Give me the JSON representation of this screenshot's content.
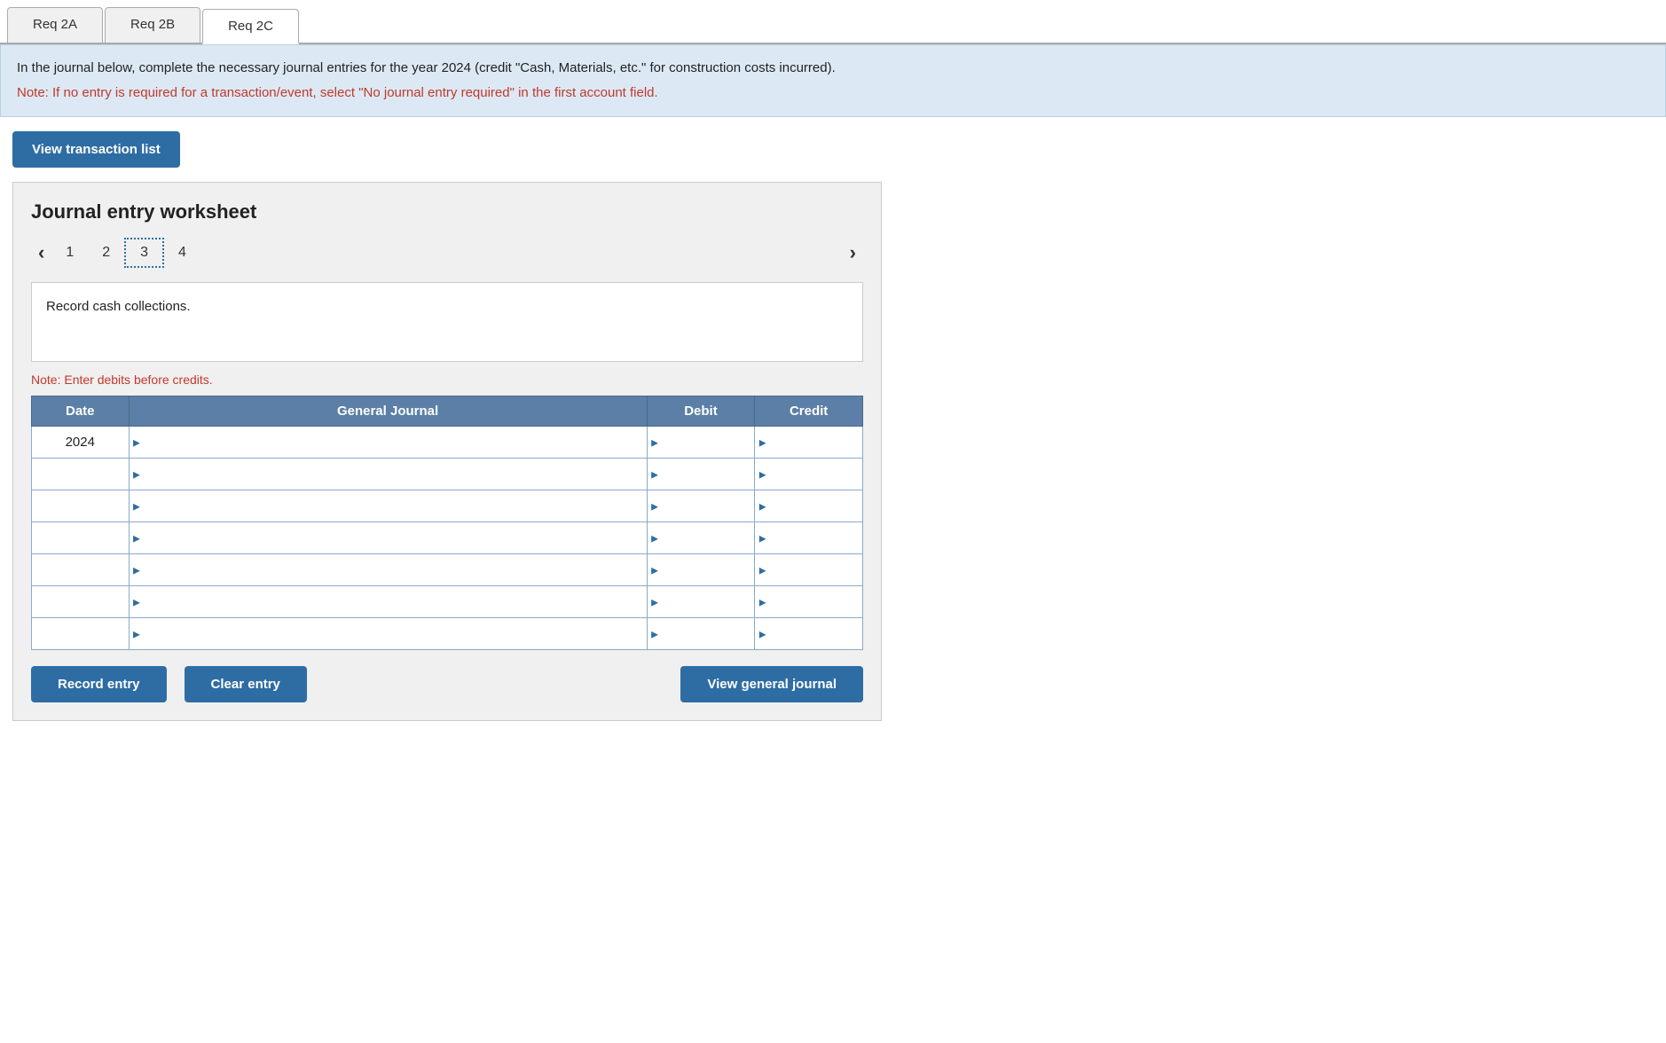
{
  "tabs": [
    {
      "id": "req2a",
      "label": "Req 2A",
      "active": false
    },
    {
      "id": "req2b",
      "label": "Req 2B",
      "active": false
    },
    {
      "id": "req2c",
      "label": "Req 2C",
      "active": true
    }
  ],
  "instruction": {
    "main": "In the journal below, complete the necessary journal entries for the year 2024 (credit \"Cash, Materials, etc.\" for construction costs incurred).",
    "note": "Note: If no entry is required for a transaction/event, select \"No journal entry required\" in the first account field."
  },
  "view_transaction_btn": "View transaction list",
  "worksheet": {
    "title": "Journal entry worksheet",
    "steps": [
      {
        "num": "1",
        "active": false
      },
      {
        "num": "2",
        "active": false
      },
      {
        "num": "3",
        "active": true
      },
      {
        "num": "4",
        "active": false
      }
    ],
    "record_description": "Record cash collections.",
    "note_debits": "Note: Enter debits before credits.",
    "table": {
      "headers": [
        "Date",
        "General Journal",
        "Debit",
        "Credit"
      ],
      "rows": [
        {
          "date": "2024",
          "gj": "",
          "debit": "",
          "credit": ""
        },
        {
          "date": "",
          "gj": "",
          "debit": "",
          "credit": ""
        },
        {
          "date": "",
          "gj": "",
          "debit": "",
          "credit": ""
        },
        {
          "date": "",
          "gj": "",
          "debit": "",
          "credit": ""
        },
        {
          "date": "",
          "gj": "",
          "debit": "",
          "credit": ""
        },
        {
          "date": "",
          "gj": "",
          "debit": "",
          "credit": ""
        },
        {
          "date": "",
          "gj": "",
          "debit": "",
          "credit": ""
        }
      ]
    }
  },
  "buttons": {
    "record_entry": "Record entry",
    "clear_entry": "Clear entry",
    "view_general_journal": "View general journal"
  }
}
